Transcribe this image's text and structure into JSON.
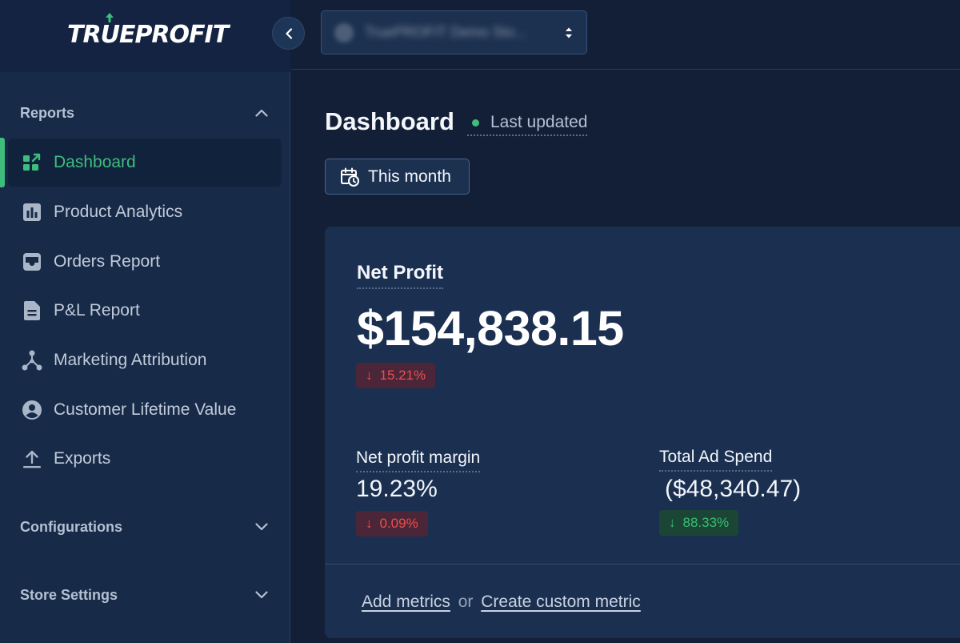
{
  "brand": {
    "logo_part1": "TR",
    "logo_u": "U",
    "logo_part2": "EPR",
    "logo_o": "O",
    "logo_part3": "FIT"
  },
  "header": {
    "store_name": "TruePROFIT Demo Sto...",
    "collapse_icon": "chevron-left-icon",
    "select_icon": "chevron-up-down-icon"
  },
  "sidebar": {
    "sections": [
      {
        "label": "Reports",
        "expanded": true
      },
      {
        "label": "Configurations",
        "expanded": false
      },
      {
        "label": "Store Settings",
        "expanded": false
      }
    ],
    "items": [
      {
        "label": "Dashboard",
        "icon": "dashboard-icon",
        "active": true
      },
      {
        "label": "Product Analytics",
        "icon": "bar-chart-icon"
      },
      {
        "label": "Orders Report",
        "icon": "inbox-icon"
      },
      {
        "label": "P&L Report",
        "icon": "document-icon"
      },
      {
        "label": "Marketing Attribution",
        "icon": "network-icon"
      },
      {
        "label": "Customer Lifetime Value",
        "icon": "user-circle-icon"
      },
      {
        "label": "Exports",
        "icon": "upload-icon"
      }
    ]
  },
  "page": {
    "title": "Dashboard",
    "last_updated": "Last updated",
    "date_range": "This month"
  },
  "metrics": {
    "net_profit": {
      "label": "Net Profit",
      "value": "$154,838.15",
      "change": "15.21%",
      "direction": "down",
      "sentiment": "negative"
    },
    "net_profit_margin": {
      "label": "Net profit margin",
      "value": "19.23%",
      "change": "0.09%",
      "direction": "down",
      "sentiment": "negative"
    },
    "total_ad_spend": {
      "label": "Total Ad Spend",
      "value": "($48,340.47)",
      "change": "88.33%",
      "direction": "down",
      "sentiment": "positive"
    }
  },
  "footer": {
    "add_metrics": "Add metrics",
    "or": "or",
    "create_custom": "Create custom metric"
  },
  "colors": {
    "accent_green": "#3ebd7c",
    "negative_red": "#ea4f4f",
    "background": "#131f36",
    "sidebar": "#172a47",
    "card": "#1b3050"
  }
}
